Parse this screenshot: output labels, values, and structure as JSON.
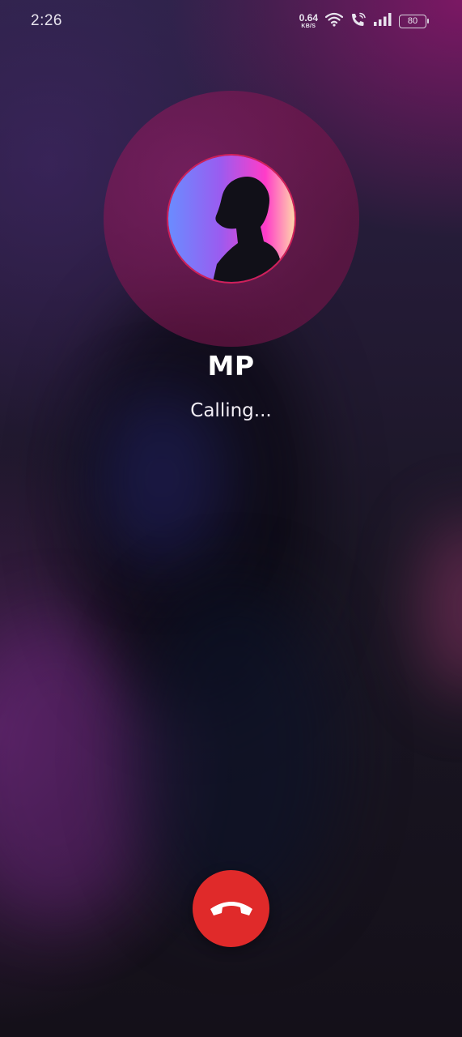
{
  "status_bar": {
    "time": "2:26",
    "net_speed_value": "0.64",
    "net_speed_unit": "KB/S",
    "battery_level": "80",
    "icons": [
      "wifi-icon",
      "wifi-calling-icon",
      "signal-icon",
      "battery-icon"
    ]
  },
  "call": {
    "caller_name": "MP",
    "status_text": "Calling...",
    "end_call_icon": "phone-hangup-icon"
  },
  "colors": {
    "end_call": "#e02a2a",
    "avatar_ring": "#8c1e64",
    "avatar_border": "#d0205a"
  }
}
